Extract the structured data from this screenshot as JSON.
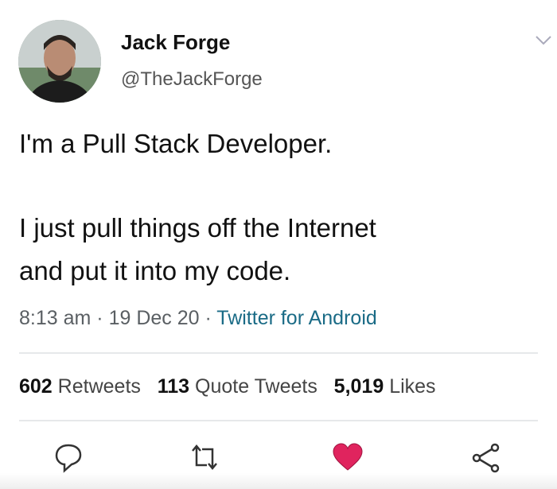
{
  "user": {
    "name": "Jack Forge",
    "handle": "@TheJackForge"
  },
  "tweet": {
    "line1": "I'm a Pull Stack Developer.",
    "line2": "I just pull things off the Internet",
    "line3": "and put it into my code."
  },
  "meta": {
    "time": "8:13 am",
    "sep1": " · ",
    "date": "19 Dec 20",
    "sep2": " · ",
    "source": "Twitter for Android"
  },
  "stats": {
    "retweets_count": "602",
    "retweets_label": "Retweets",
    "quotes_count": "113",
    "quotes_label": "Quote Tweets",
    "likes_count": "5,019",
    "likes_label": "Likes"
  },
  "icons": {
    "reply": "speech-bubble-icon",
    "retweet": "retweet-icon",
    "like": "heart-icon",
    "share": "share-icon",
    "more": "chevron-down-icon"
  },
  "colors": {
    "like": "#e0245e",
    "source_link": "#1a6b86"
  }
}
